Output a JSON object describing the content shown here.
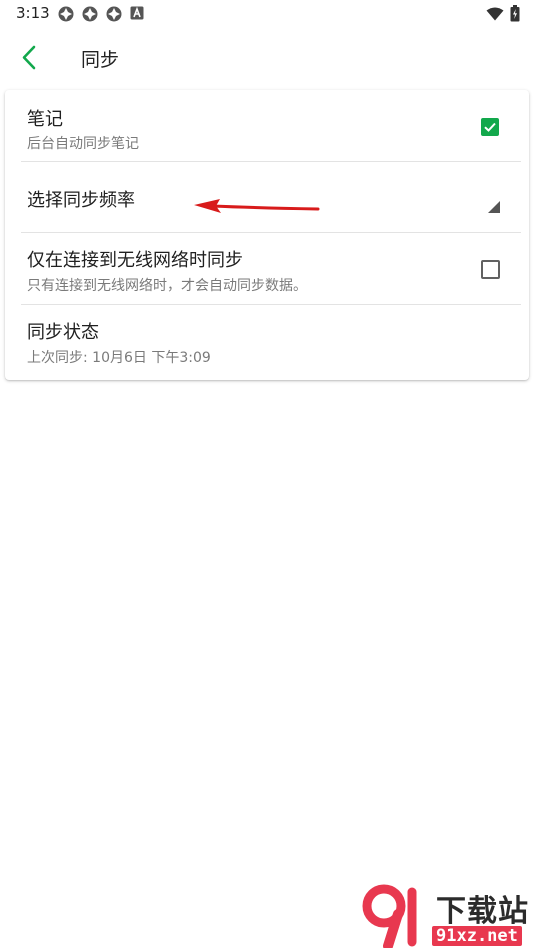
{
  "status_bar": {
    "time": "3:13",
    "notification_icons": [
      "app-icon",
      "app-icon",
      "app-icon",
      "a-icon"
    ],
    "right_icons": [
      "wifi-icon",
      "battery-icon"
    ]
  },
  "app_bar": {
    "back_icon": "chevron-left-icon",
    "title": "同步",
    "accent": "#12a84c"
  },
  "settings": {
    "notes": {
      "title": "笔记",
      "subtitle": "后台自动同步笔记",
      "checked": true
    },
    "frequency": {
      "title": "选择同步频率"
    },
    "wifi_only": {
      "title": "仅在连接到无线网络时同步",
      "subtitle": "只有连接到无线网络时，才会自动同步数据。",
      "checked": false
    },
    "status": {
      "title": "同步状态",
      "subtitle": "上次同步: 10月6日 下午3:09"
    }
  },
  "annotation": {
    "color": "#d81b1b"
  },
  "watermark": {
    "top_text": "下载站",
    "bottom_text": "91xz.net",
    "color": "#e8384f"
  }
}
